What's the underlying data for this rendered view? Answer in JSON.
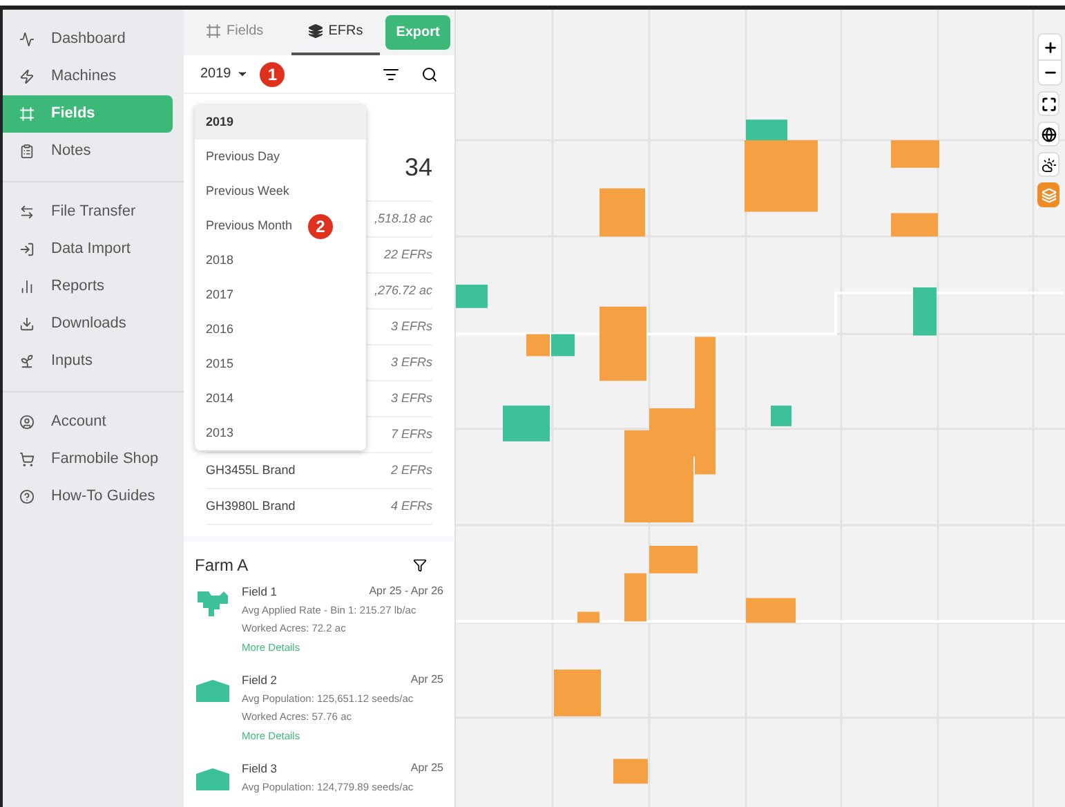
{
  "sidebar": {
    "groups": [
      [
        {
          "label": "Dashboard",
          "selected": false
        },
        {
          "label": "Machines",
          "selected": false
        },
        {
          "label": "Fields",
          "selected": true
        },
        {
          "label": "Notes",
          "selected": false
        }
      ],
      [
        {
          "label": "File Transfer",
          "selected": false
        },
        {
          "label": "Data Import",
          "selected": false
        },
        {
          "label": "Reports",
          "selected": false
        },
        {
          "label": "Downloads",
          "selected": false
        },
        {
          "label": "Inputs",
          "selected": false
        }
      ],
      [
        {
          "label": "Account",
          "selected": false
        },
        {
          "label": "Farmobile Shop",
          "selected": false
        },
        {
          "label": "How-To Guides",
          "selected": false
        }
      ]
    ]
  },
  "tabs": [
    {
      "label": "Fields",
      "selected": false
    },
    {
      "label": "EFRs",
      "selected": true
    }
  ],
  "export_button": "Export",
  "year_filter": {
    "value": "2019",
    "marker": "1"
  },
  "dropdown": {
    "marker": "2",
    "options": [
      {
        "label": "2019",
        "selected": true
      },
      {
        "label": "Previous Day",
        "selected": false
      },
      {
        "label": "Previous Week",
        "selected": false
      },
      {
        "label": "Previous Month",
        "selected": false
      },
      {
        "label": "2018",
        "selected": false
      },
      {
        "label": "2017",
        "selected": false
      },
      {
        "label": "2016",
        "selected": false
      },
      {
        "label": "2015",
        "selected": false
      },
      {
        "label": "2014",
        "selected": false
      },
      {
        "label": "2013",
        "selected": false
      }
    ]
  },
  "summary_rows": [
    {
      "kind": "count",
      "value": "34"
    },
    {
      "kind": "acres",
      "value": ",518.18 ac"
    },
    {
      "kind": "efrs",
      "value": "22 EFRs"
    },
    {
      "kind": "acres",
      "value": ",276.72 ac"
    },
    {
      "kind": "efrs",
      "value": "3 EFRs"
    },
    {
      "kind": "efrs",
      "value": "3 EFRs"
    },
    {
      "kind": "efrs",
      "value": "3 EFRs"
    },
    {
      "kind": "efrs",
      "value": "7 EFRs"
    },
    {
      "kind": "efrs",
      "label": "GH3455L Brand",
      "value": "2 EFRs"
    },
    {
      "kind": "efrs",
      "label": "GH3980L Brand",
      "value": "4 EFRs"
    }
  ],
  "farm": {
    "title": "Farm A",
    "fields": [
      {
        "name": "Field 1",
        "date": "Apr 25 - Apr 26",
        "lines": [
          "Avg Applied Rate - Bin 1: 215.27 lb/ac",
          "Worked Acres: 72.2 ac"
        ],
        "link": "More Details"
      },
      {
        "name": "Field 2",
        "date": "Apr 25",
        "lines": [
          "Avg Population: 125,651.12 seeds/ac",
          "Worked Acres: 57.76 ac"
        ],
        "link": "More Details"
      },
      {
        "name": "Field 3",
        "date": "Apr 25",
        "lines": [
          "Avg Population: 124,779.89 seeds/ac"
        ]
      }
    ]
  }
}
